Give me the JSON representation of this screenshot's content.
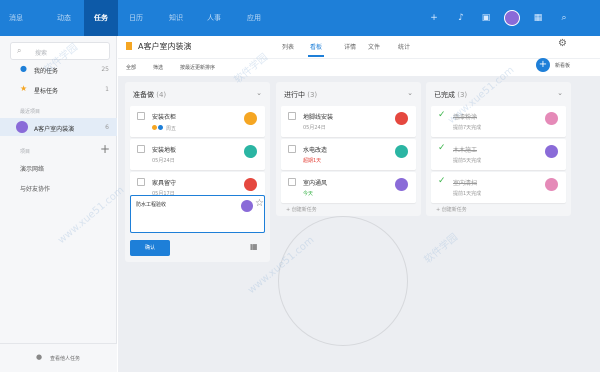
{
  "topnav": {
    "tabs": [
      "消息",
      "动态",
      "任务",
      "日历",
      "知识",
      "人事",
      "应用"
    ],
    "active_tab": "任务",
    "icons": [
      "plus-icon",
      "bell-icon",
      "doc-icon",
      "avatar",
      "grid-icon",
      "search-icon"
    ],
    "accent": "#1e7fd8"
  },
  "sidebar": {
    "search_placeholder": "搜索",
    "items": [
      {
        "label": "我的任务",
        "count": "25",
        "icon": "person-icon"
      },
      {
        "label": "星标任务",
        "count": "1",
        "icon": "star-icon"
      }
    ],
    "recent_section": "最近项目",
    "recent_project": {
      "label": "A客户室内装演",
      "count": "6"
    },
    "projects_section": "项目",
    "projects": [
      "演示网络",
      "与好友协作"
    ],
    "bottom_label": "查看他人任务"
  },
  "project": {
    "title": "A客户室内装演",
    "tabs": [
      "列表",
      "看板",
      "详情",
      "文件",
      "统计"
    ],
    "active_tab": "看板"
  },
  "toolbar": {
    "filters": [
      "全部",
      "筛选",
      "按最近更新排序"
    ],
    "new_board_label": "新看板"
  },
  "columns": [
    {
      "name": "准备做",
      "count": "(4)",
      "cards": [
        {
          "title": "安装衣柜",
          "sub": "周五",
          "sub_style": "tags",
          "done": false
        },
        {
          "title": "安装地板",
          "sub": "05月24日",
          "sub_style": "gray",
          "done": false
        },
        {
          "title": "家具留守",
          "sub": "05月17日",
          "sub_style": "gray",
          "done": false
        }
      ],
      "editor_text": "防水工程验收",
      "confirm_label": "确认"
    },
    {
      "name": "进行中",
      "count": "(3)",
      "cards": [
        {
          "title": "地脚线安装",
          "sub": "05月24日",
          "sub_style": "gray",
          "done": false
        },
        {
          "title": "水电改造",
          "sub": "超期1天",
          "sub_style": "red",
          "done": false
        },
        {
          "title": "室内通风",
          "sub": "今天",
          "sub_style": "green",
          "done": false
        }
      ],
      "new_task_label": "+ 创建新任务"
    },
    {
      "name": "已完成",
      "count": "(3)",
      "cards": [
        {
          "title": "墙漆粉涂",
          "sub": "提前7天完成",
          "sub_style": "gray",
          "done": true
        },
        {
          "title": "木木施工",
          "sub": "提前5天完成",
          "sub_style": "gray",
          "done": true
        },
        {
          "title": "室内清扫",
          "sub": "提前1天完成",
          "sub_style": "gray",
          "done": true
        }
      ],
      "new_task_label": "+ 创建新任务"
    }
  ],
  "watermark": [
    "软件学园",
    "www.xue51.com"
  ]
}
